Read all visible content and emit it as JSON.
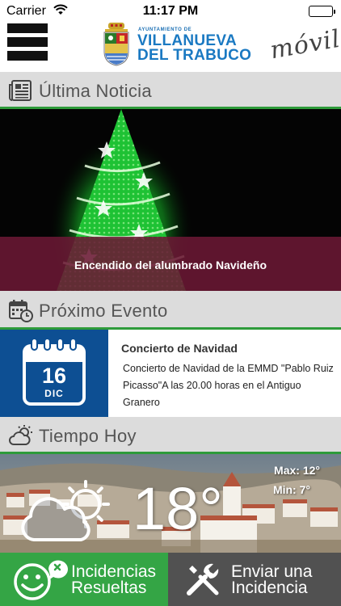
{
  "status_bar": {
    "carrier": "Carrier",
    "time": "11:17 PM",
    "wifi_icon": "wifi-icon",
    "battery_icon": "battery-full-icon"
  },
  "header": {
    "menu_icon": "hamburger-menu-icon",
    "brand_small": "AYUNTAMIENTO DE",
    "brand_line1": "VILLANUEVA",
    "brand_line2": "DEL TRABUCO",
    "movil": "móvil",
    "brand_color": "#1a79c2"
  },
  "news": {
    "section_title": "Última Noticia",
    "section_icon": "newspaper-icon",
    "caption": "Encendido del alumbrado Navideño"
  },
  "event": {
    "section_title": "Próximo Evento",
    "section_icon": "calendar-clock-icon",
    "day": "16",
    "month": "DIC",
    "title": "Concierto de Navidad",
    "description": "Concierto de Navidad de la EMMD \"Pablo Ruiz Picasso\"A las 20.00 horas en el Antiguo Granero"
  },
  "weather": {
    "section_title": "Tiempo Hoy",
    "section_icon": "partly-cloudy-icon",
    "temperature": "18°",
    "max": "Max: 12°",
    "min": "Min: 7°",
    "condition_icon": "cloud-sun-icon"
  },
  "actions": {
    "left_label_1": "Incidencias",
    "left_label_2": "Resueltas",
    "left_icon": "smiley-check-icon",
    "left_color": "#34a545",
    "right_label_1": "Enviar una",
    "right_label_2": "Incidencia",
    "right_icon": "tools-icon",
    "right_color": "#515151"
  },
  "colors": {
    "accent_green": "#2e9b3a",
    "section_bg": "#dcdcdc",
    "calendar_blue": "#0d4f93",
    "caption_bar": "#6b1834"
  }
}
